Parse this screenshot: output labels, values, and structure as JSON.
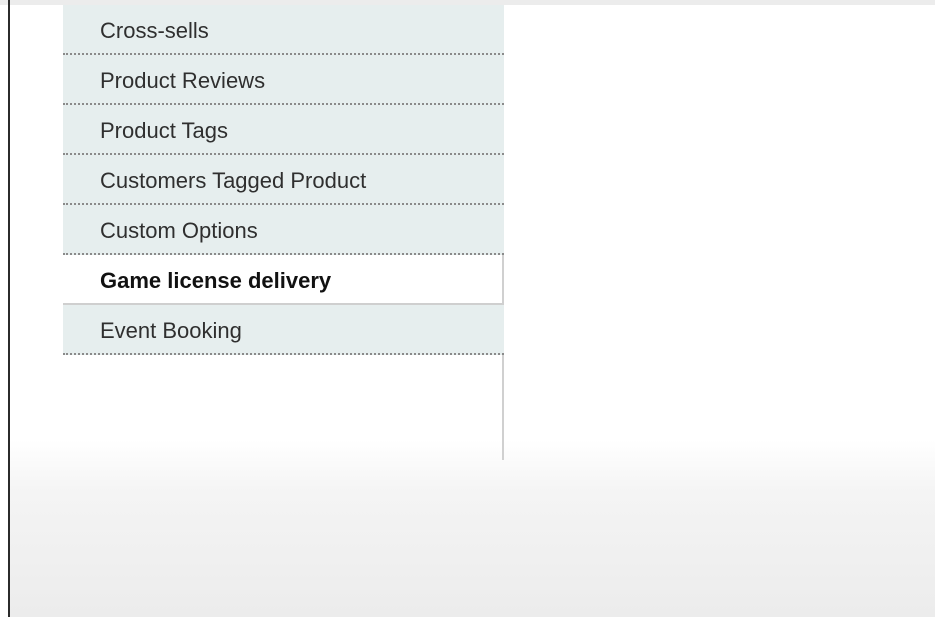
{
  "tabs": {
    "items": [
      {
        "label": "Cross-sells",
        "active": false
      },
      {
        "label": "Product Reviews",
        "active": false
      },
      {
        "label": "Product Tags",
        "active": false
      },
      {
        "label": "Customers Tagged Product",
        "active": false
      },
      {
        "label": "Custom Options",
        "active": false
      },
      {
        "label": "Game license delivery",
        "active": true
      },
      {
        "label": "Event Booking",
        "active": false
      }
    ]
  },
  "colors": {
    "tab_background": "#e6eeee",
    "active_tab_background": "#ffffff",
    "separator": "#8a8a8a"
  }
}
